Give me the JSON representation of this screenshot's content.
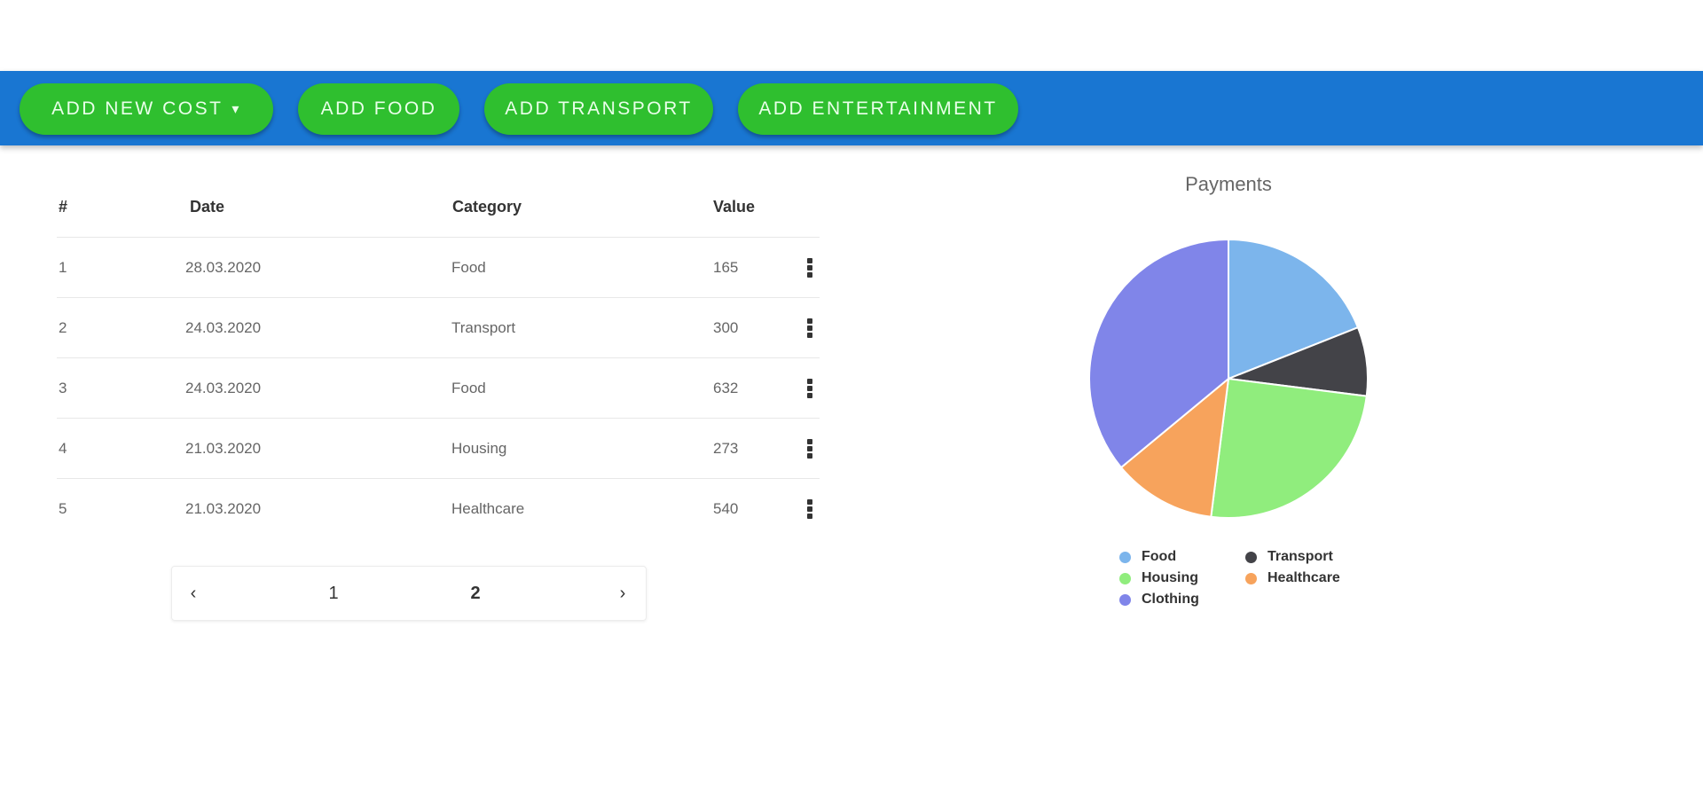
{
  "toolbar": {
    "buttons": [
      {
        "label": "ADD NEW COST",
        "caret": "▾"
      },
      {
        "label": "ADD FOOD"
      },
      {
        "label": "ADD TRANSPORT"
      },
      {
        "label": "ADD ENTERTAINMENT"
      }
    ],
    "colors": {
      "bar": "#1976d2",
      "button": "#2fbf2f"
    }
  },
  "table": {
    "headers": [
      "#",
      "Date",
      "Category",
      "Value"
    ],
    "rows": [
      {
        "num": "1",
        "date": "28.03.2020",
        "category": "Food",
        "value": "165"
      },
      {
        "num": "2",
        "date": "24.03.2020",
        "category": "Transport",
        "value": "300"
      },
      {
        "num": "3",
        "date": "24.03.2020",
        "category": "Food",
        "value": "632"
      },
      {
        "num": "4",
        "date": "21.03.2020",
        "category": "Housing",
        "value": "273"
      },
      {
        "num": "5",
        "date": "21.03.2020",
        "category": "Healthcare",
        "value": "540"
      }
    ],
    "row_menu_icon": "more-vertical-icon"
  },
  "pagination": {
    "prev": "‹",
    "pages": [
      "1",
      "2"
    ],
    "current": "2",
    "next": "›"
  },
  "chart_data": {
    "type": "pie",
    "title": "Payments",
    "legend_position": "bottom",
    "slices": [
      {
        "label": "Food",
        "value": 19,
        "color": "#7cb5ec"
      },
      {
        "label": "Transport",
        "value": 8,
        "color": "#434348"
      },
      {
        "label": "Housing",
        "value": 25,
        "color": "#90ed7d"
      },
      {
        "label": "Healthcare",
        "value": 12,
        "color": "#f7a35c"
      },
      {
        "label": "Clothing",
        "value": 36,
        "color": "#8085e9"
      }
    ]
  }
}
